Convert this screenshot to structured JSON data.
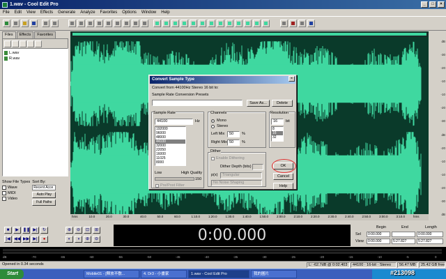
{
  "window": {
    "title": "1.wav - Cool Edit Pro"
  },
  "menu": [
    "File",
    "Edit",
    "View",
    "Effects",
    "Generate",
    "Analyze",
    "Favorites",
    "Options",
    "Window",
    "Help"
  ],
  "panel": {
    "tabs": [
      "Files",
      "Effects",
      "Favorites"
    ],
    "files": [
      "L.wav",
      "R.wav"
    ],
    "show_types_label": "Show File Types",
    "sort_label": "Sort By:",
    "types": [
      "Wave",
      "MIDI",
      "Video"
    ],
    "sort_value": "Recent Acce",
    "autoplay": "Auto Play",
    "fullpath": "Full Paths"
  },
  "db_scale": [
    "dB",
    "-30",
    "-20",
    "-10",
    "-10",
    "-20",
    "-30",
    "dB",
    "-20",
    "-10",
    "-10",
    "-20",
    "-30",
    "dB"
  ],
  "ruler": [
    "hms",
    "10.0",
    "20.0",
    "30.0",
    "40.0",
    "50.0",
    "60.0",
    "1:10.0",
    "1:20.0",
    "1:30.0",
    "1:40.0",
    "1:50.0",
    "2:00.0",
    "2:10.0",
    "2:20.0",
    "2:30.0",
    "2:40.0",
    "2:50.0",
    "3:00.0",
    "3:10.0",
    "hms"
  ],
  "time_display": "0:00.000",
  "selection": {
    "begin": "Begin",
    "end": "End",
    "length": "Length",
    "sel": "Sel",
    "view": "View",
    "sel_begin": "0:00.000",
    "sel_end": "",
    "sel_len": "0:00.000",
    "view_begin": "0:00.000",
    "view_end": "5:27.827",
    "view_len": "5:27.827"
  },
  "level_scale": [
    "dB",
    "-70",
    "-65",
    "-60",
    "-55",
    "-50",
    "-45",
    "-40",
    "-35",
    "-30",
    "-25",
    "-20",
    "-15",
    "-10",
    "-5",
    "0"
  ],
  "status": {
    "opened": "Opened in 0.34 seconds",
    "level": "L: -62.7dB @ 0:02.403",
    "format": "44100 · 16-bit · Stereo",
    "size": "56.47 MB",
    "free": "25.42 GB free"
  },
  "taskbar": {
    "start": "Start",
    "tasks": [
      "Mobile01 - [釋放不敷...",
      "4. Dr3 - 小畫家",
      "1.wav - Cool Edit Pro",
      "我的圖片"
    ],
    "clock": "下午 01:18"
  },
  "watermark": "#213098",
  "dialog": {
    "title": "Convert Sample Type",
    "convert_from": "Convert from 44100Hz Stereo 16 bit to:",
    "presets_label": "Sample Rate Conversion Presets",
    "save_as": "Save As...",
    "delete": "Delete",
    "sample_rate_label": "Sample Rate",
    "sample_rate_value": "44100",
    "hz": "Hz",
    "rates": [
      "192000",
      "96000",
      "48000",
      "44100",
      "32000",
      "22050",
      "16000",
      "11025",
      "8000"
    ],
    "low": "Low",
    "high_quality": "High Quality",
    "quality_value": "150",
    "prefilter": "Pre/Post Filter",
    "channels_label": "Channels",
    "mono": "Mono",
    "stereo": "Stereo",
    "left_mix": "Left Mix",
    "right_mix": "Right Mix",
    "left_mix_value": "50",
    "right_mix_value": "50",
    "pct": "%",
    "dither_label": "Dither",
    "enable_dither": "Enable Dithering",
    "dither_depth": "Dither Depth (bits)",
    "pdf": "p(x)",
    "triangular": "Triangular",
    "noise_shaping": "No Noise Shaping",
    "resolution_label": "Resolution",
    "resolution_value": "16",
    "bit": "bit",
    "bits": [
      "8",
      "16",
      "32"
    ],
    "ok": "OK",
    "cancel": "Cancel",
    "help": "Help"
  },
  "colors": {
    "wave": "#3fd8a0",
    "wave_bg": "#0a3a2a",
    "titlebar": "#0a246a",
    "highlight_ring": "#e03030"
  }
}
